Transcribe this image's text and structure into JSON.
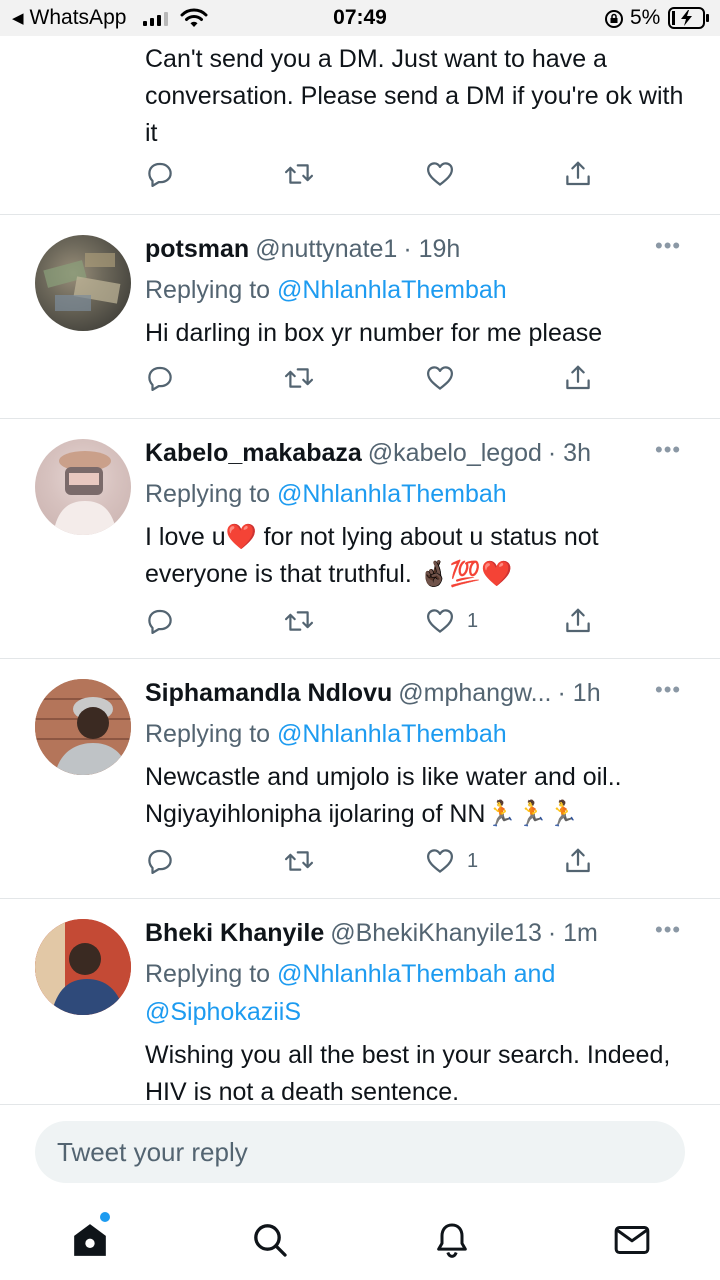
{
  "status_bar": {
    "back_app": "WhatsApp",
    "time": "07:49",
    "battery": "5%"
  },
  "tweets": [
    {
      "text": "Can't send you a DM. Just want to have a conversation. Please send a DM if you're ok with it",
      "likes": ""
    },
    {
      "name": "potsman",
      "handle": "@nuttynate1",
      "time": "· 19h",
      "replying_label": "Replying to",
      "mention": "@NhlanhlaThembah",
      "text": "Hi darling in box yr number for me please",
      "likes": ""
    },
    {
      "name": "Kabelo_makabaza",
      "handle": "@kabelo_legod",
      "time": "· 3h",
      "replying_label": "Replying to",
      "mention": "@NhlanhlaThembah",
      "text": "I love u❤️ for not lying about u status not everyone is that truthful. 🤞🏿💯❤️",
      "likes": "1"
    },
    {
      "name": "Siphamandla Ndlovu",
      "handle": "@mphangw...",
      "time": "· 1h",
      "replying_label": "Replying to",
      "mention": "@NhlanhlaThembah",
      "text": "Newcastle and umjolo is like water and oil.. Ngiyayihlonipha ijolaring of NN🏃🏃🏃",
      "likes": "1"
    },
    {
      "name": "Bheki Khanyile",
      "handle": "@BhekiKhanyile13",
      "time": "· 1m",
      "replying_label": "Replying to",
      "mention": "@NhlanhlaThembah and @SiphokaziiS",
      "text": "Wishing you all the best in your search. Indeed, HIV is not a death sentence.",
      "likes": ""
    }
  ],
  "reply_box": {
    "placeholder": "Tweet your reply"
  },
  "icons": {
    "reply": "reply-icon",
    "retweet": "retweet-icon",
    "like": "heart-icon",
    "share": "share-icon",
    "nav": [
      "home-icon",
      "search-icon",
      "notifications-icon",
      "messages-icon"
    ]
  },
  "colors": {
    "accent": "#1d9bf0",
    "text": "#0f1419",
    "secondary": "#536471"
  }
}
